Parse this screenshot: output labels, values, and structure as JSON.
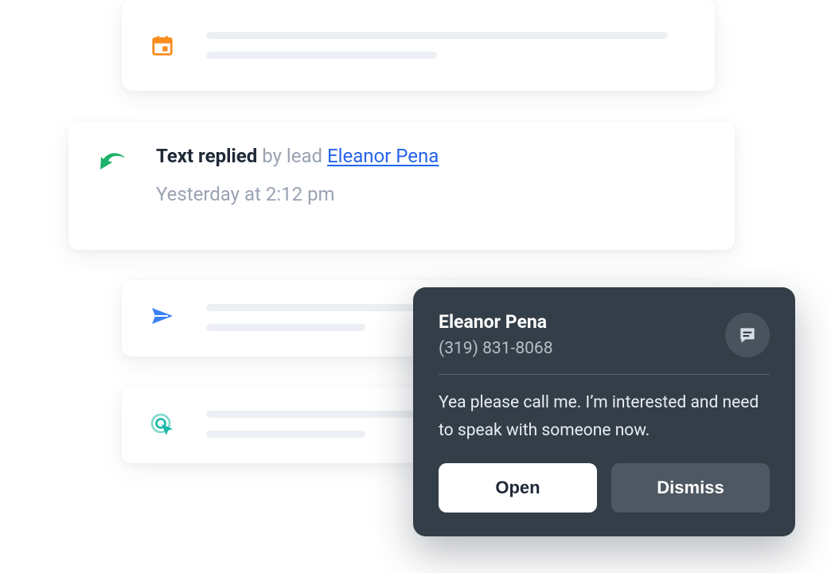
{
  "reply_card": {
    "action": "Text replied",
    "by": "by lead",
    "lead_name": "Eleanor Pena",
    "timestamp": "Yesterday at 2:12 pm"
  },
  "toast": {
    "name": "Eleanor Pena",
    "phone": "(319) 831-8068",
    "message": "Yea please call me. I’m interested and need to speak with someone now.",
    "open_label": "Open",
    "dismiss_label": "Dismiss"
  }
}
